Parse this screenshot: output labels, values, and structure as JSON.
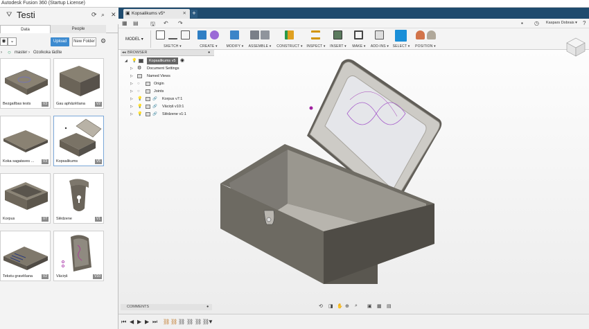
{
  "window": {
    "title": "Autodesk Fusion 360 (Startup License)"
  },
  "data_panel": {
    "project_title": "Testi",
    "tabs": [
      "Data",
      "People"
    ],
    "upload_label": "Upload",
    "new_folder_label": "New Folder",
    "breadcrumb": [
      "master",
      "Ozolkoka lādīte"
    ],
    "items": [
      {
        "name": "Bezgalības tests",
        "version": "V3"
      },
      {
        "name": "Gau aphāzēšana",
        "version": "V2"
      },
      {
        "name": "Koka sagataves ...",
        "version": "V3"
      },
      {
        "name": "Kopsalikums",
        "version": "V5"
      },
      {
        "name": "Korpus",
        "version": "V7"
      },
      {
        "name": "Slēdzene",
        "version": "V1"
      },
      {
        "name": "Tekstu gravēšana",
        "version": "V2"
      },
      {
        "name": "Vāciņš",
        "version": "V10"
      }
    ]
  },
  "document_tab": {
    "label": "Kopsalikums v5*"
  },
  "user": {
    "name": "Kaspars Dobrais ▾"
  },
  "ribbon": {
    "workspace": "MODEL ▾",
    "groups": [
      "SKETCH ▾",
      "CREATE ▾",
      "MODIFY ▾",
      "ASSEMBLE ▾",
      "CONSTRUCT ▾",
      "INSPECT ▾",
      "INSERT ▾",
      "MAKE ▾",
      "ADD-INS ▾",
      "SELECT ▾",
      "POSITION ▾"
    ]
  },
  "browser": {
    "title": "BROWSER",
    "root": "Kopsalikums v5",
    "nodes": [
      "Document Settings",
      "Named Views",
      "Origin",
      "Joints",
      "Korpus v7:1",
      "Vāciņš v10:1",
      "Slēdzene v1:1"
    ]
  },
  "comments": {
    "title": "COMMENTS"
  },
  "colors": {
    "accent": "#3d8bd0",
    "titlebar": "#1f4b6e",
    "select_active": "#1a8fd8",
    "model_body": "#6f6c64"
  }
}
